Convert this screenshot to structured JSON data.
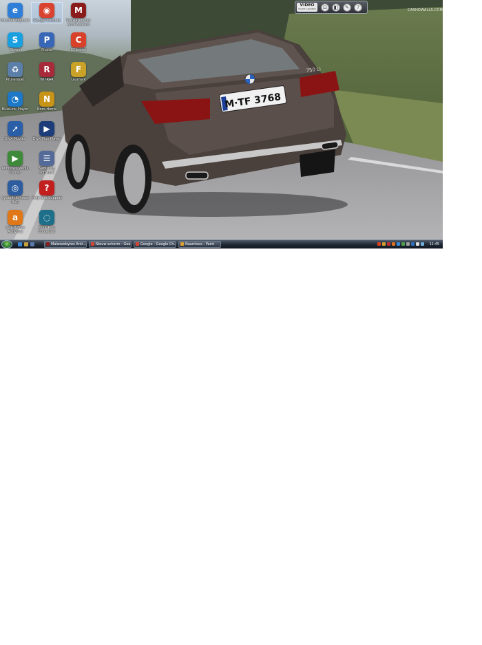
{
  "desktop": {
    "icons": [
      {
        "label": "Internet Explorer",
        "glyph": "e",
        "color": "#2f7fd8"
      },
      {
        "label": "Google Chrome",
        "glyph": "◉",
        "color": "#d9432f"
      },
      {
        "label": "Malwarebytes Anti-Malware",
        "glyph": "M",
        "color": "#8a1c1c"
      },
      {
        "label": "Skype",
        "glyph": "S",
        "color": "#19a0e0"
      },
      {
        "label": "Picasa",
        "glyph": "P",
        "color": "#3867b8"
      },
      {
        "label": "CCleaner",
        "glyph": "C",
        "color": "#d8402a"
      },
      {
        "label": "Prullenbak",
        "glyph": "♻",
        "color": "#5b7fa8"
      },
      {
        "label": "WinRAR",
        "glyph": "R",
        "color": "#a82a3a"
      },
      {
        "label": "Lexmark",
        "glyph": "F",
        "color": "#c9a227"
      },
      {
        "label": "BlueLink Player",
        "glyph": "◔",
        "color": "#1e78c8"
      },
      {
        "label": "Nero Home",
        "glyph": "N",
        "color": "#c89418"
      },
      {
        "label": "DivX Movies",
        "glyph": "➚",
        "color": "#2a5fa8"
      },
      {
        "label": "DivX Plus Player",
        "glyph": "▶",
        "color": "#1c3d7a"
      },
      {
        "label": "Windows Media Center",
        "glyph": "▶",
        "color": "#3f8a3a"
      },
      {
        "label": "Samsung software",
        "glyph": "☰",
        "color": "#546b9a"
      },
      {
        "label": "Cyberlink Power DVD",
        "glyph": "◎",
        "color": "#2d5d9e"
      },
      {
        "label": "Help and Support",
        "glyph": "?",
        "color": "#c21f1f"
      },
      {
        "label": "avast! Free Antivirus",
        "glyph": "a",
        "color": "#e07818"
      },
      {
        "label": "DivX Plus Converter",
        "glyph": "◌",
        "color": "#1d6f8a"
      }
    ],
    "car": {
      "plate": "M·TF 3768",
      "model": "750 Li"
    },
    "watermark": "CARHDWALLS.COM"
  },
  "video_widget": {
    "logo": "VIDEO",
    "sub": "FRAME GRABBER",
    "buttons": [
      {
        "name": "camera-icon",
        "glyph": "⊡"
      },
      {
        "name": "record-icon",
        "glyph": "◧"
      },
      {
        "name": "settings-icon",
        "glyph": "✎"
      },
      {
        "name": "help-icon",
        "glyph": "?"
      }
    ]
  },
  "taskbar": {
    "quick_launch": [
      {
        "name": "ie-quicklaunch-icon",
        "color": "#3a86d6"
      },
      {
        "name": "show-desktop-icon",
        "color": "#c8a040"
      },
      {
        "name": "switch-windows-icon",
        "color": "#5a7ab0"
      }
    ],
    "tasks": [
      {
        "label": "Malwarebytes Anti-...",
        "color": "#8a1c1c"
      },
      {
        "label": "Nieuw scherm - Goo...",
        "color": "#d9432f"
      },
      {
        "label": "Google - Google Ch...",
        "color": "#d9432f"
      },
      {
        "label": "Naamloos - Paint",
        "color": "#e0a030"
      }
    ],
    "tray_icons": [
      "#e04020",
      "#d0a030",
      "#c03030",
      "#e07020",
      "#3a8ad8",
      "#50a050",
      "#a0a0a0",
      "#3070c0",
      "#e0e0e0",
      "#70b0e0"
    ],
    "clock": "11:45"
  }
}
